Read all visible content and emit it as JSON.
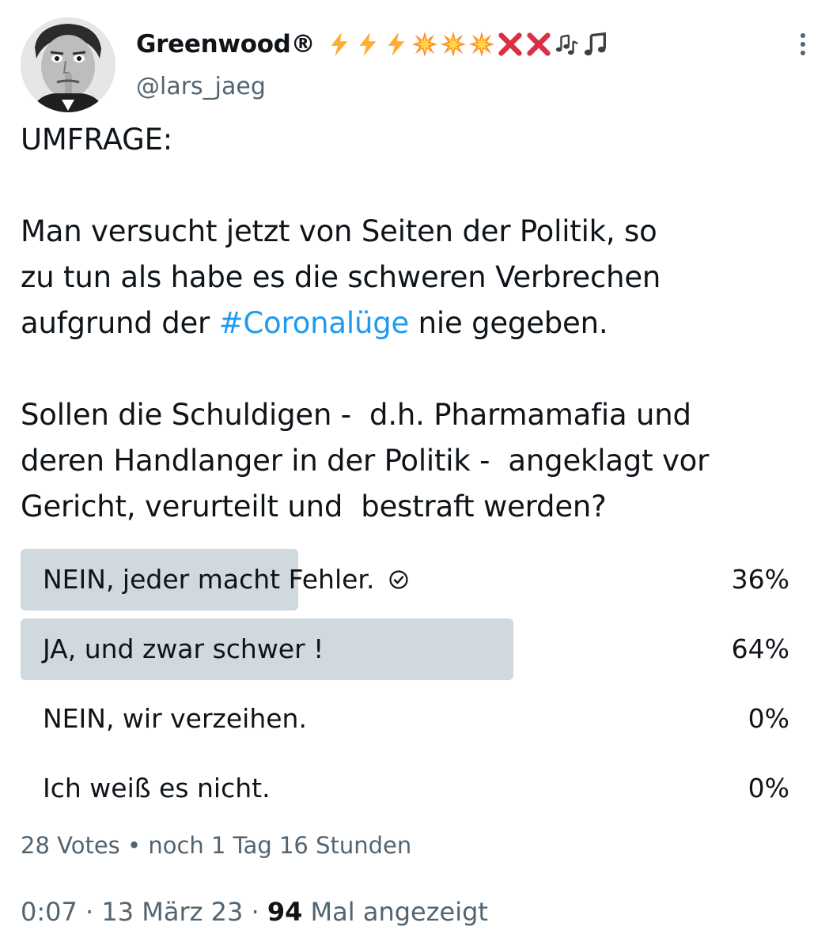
{
  "author": {
    "display_name": "Greenwood®",
    "name_emojis": [
      "high-voltage-icon",
      "high-voltage-icon",
      "high-voltage-icon",
      "collision-icon",
      "collision-icon",
      "collision-icon",
      "cross-mark-icon",
      "cross-mark-icon",
      "musical-notes-icon",
      "musical-note-icon"
    ],
    "handle": "@lars_jaeg"
  },
  "tweet": {
    "line_heading": "UMFRAGE:",
    "para2_before": "Man versucht jetzt von Seiten der Politik, so\nzu tun als habe es die schweren Verbrechen\naufgrund der ",
    "hashtag": "#Coronalüge",
    "para2_after": " nie gegeben.",
    "para3": "Sollen die Schuldigen -  d.h. Pharmamafia und\nderen Handlanger in der Politik -  angeklagt vor\nGericht, verurteilt und  bestraft werden?"
  },
  "poll": {
    "options": [
      {
        "label": "NEIN, jeder macht Fehler.",
        "percent_label": "36%",
        "fraction": 0.36,
        "own_vote": true
      },
      {
        "label": "JA, und zwar schwer !",
        "percent_label": "64%",
        "fraction": 0.64,
        "own_vote": false
      },
      {
        "label": "NEIN, wir verzeihen.",
        "percent_label": "0%",
        "fraction": 0,
        "own_vote": false
      },
      {
        "label": "Ich weiß es nicht.",
        "percent_label": "0%",
        "fraction": 0,
        "own_vote": false
      }
    ],
    "votes": "28 Votes",
    "separator": " • ",
    "remaining": "noch 1 Tag 16 Stunden"
  },
  "meta": {
    "time": "0:07",
    "dot": " · ",
    "date": "13 März 23",
    "views_count": "94",
    "views_label": " Mal angezeigt"
  },
  "colors": {
    "text": "#0f1419",
    "secondary": "#536471",
    "link": "#1d9bf0",
    "poll_bar": "#cfd9de"
  }
}
